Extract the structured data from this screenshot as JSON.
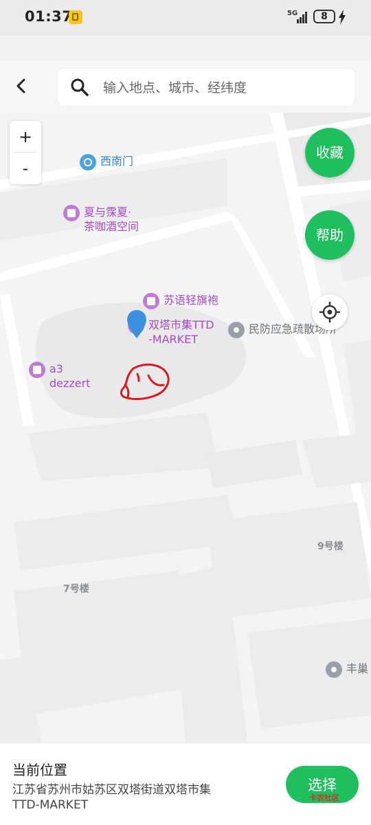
{
  "status_bar": {
    "time": "01:37",
    "network": "5G",
    "battery": "8"
  },
  "search": {
    "placeholder": "输入地点、城市、经纬度"
  },
  "map": {
    "zoom_in": "+",
    "zoom_out": "-",
    "favorite_label": "收藏",
    "help_label": "帮助",
    "pois": [
      {
        "label": "西南门",
        "color": "blue"
      },
      {
        "label": "夏与霂夏·\n茶咖酒空间",
        "color": "purple"
      },
      {
        "label": "苏语轻旗袍",
        "color": "purple"
      },
      {
        "label": "双塔市集TTD\n-MARKET",
        "color": "purple"
      },
      {
        "label": "民防应急疏散场所",
        "color": "gray"
      },
      {
        "label": "a3\ndezzert",
        "color": "purple"
      },
      {
        "label": "丰巢",
        "color": "gray"
      }
    ],
    "buildings": [
      "9号楼",
      "7号楼"
    ]
  },
  "bottom_sheet": {
    "title": "当前位置",
    "address": "江苏省苏州市姑苏区双塔街道双塔市集\nTTD-MARKET",
    "select_label": "选择"
  },
  "watermark": "卡农社区",
  "colors": {
    "accent_green": "#1fbf5f",
    "poi_purple": "#a648c8",
    "poi_blue": "#2c86c6",
    "pin_blue": "#3d8fe0"
  }
}
